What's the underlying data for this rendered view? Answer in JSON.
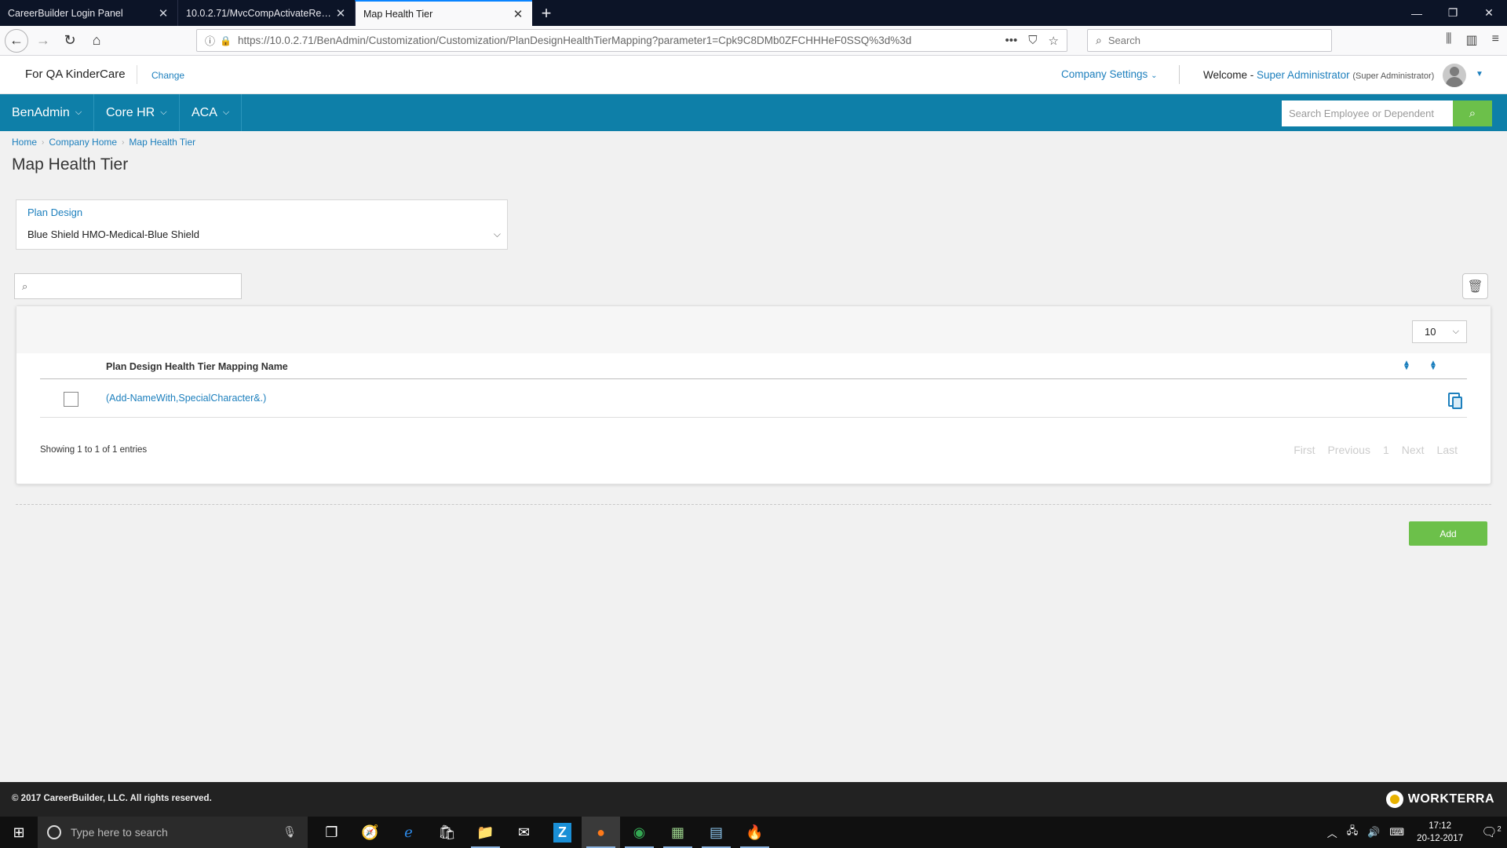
{
  "browser": {
    "tabs": [
      {
        "title": "CareerBuilder Login Panel",
        "active": false
      },
      {
        "title": "10.0.2.71/MvcCompActivateRestore",
        "active": false
      },
      {
        "title": "Map Health Tier",
        "active": true
      }
    ],
    "url": "https://10.0.2.71/BenAdmin/Customization/Customization/PlanDesignHealthTierMapping?parameter1=Cpk9C8DMb0ZFCHHHeF0SSQ%3d%3d",
    "search_placeholder": "Search"
  },
  "header": {
    "company": "For QA KinderCare",
    "change_label": "Change",
    "company_settings": "Company Settings",
    "welcome": "Welcome -",
    "user_name": "Super Administrator",
    "user_role": "(Super Administrator)"
  },
  "nav": {
    "menus": [
      "BenAdmin",
      "Core HR",
      "ACA"
    ],
    "search_placeholder": "Search Employee or Dependent"
  },
  "breadcrumb": [
    "Home",
    "Company Home",
    "Map Health Tier"
  ],
  "page_title": "Map Health Tier",
  "plan_design": {
    "label": "Plan Design",
    "value": "Blue Shield HMO-Medical-Blue Shield"
  },
  "grid": {
    "page_size": "10",
    "column_header": "Plan Design Health Tier Mapping Name",
    "rows": [
      {
        "name": "(Add-NameWith,SpecialCharacter&.)"
      }
    ],
    "showing": "Showing 1 to 1 of 1 entries",
    "pager": [
      "First",
      "Previous",
      "1",
      "Next",
      "Last"
    ]
  },
  "add_label": "Add",
  "footer": {
    "copyright": "© 2017 CareerBuilder, LLC. All rights reserved.",
    "brand": "WORKTERRA"
  },
  "taskbar": {
    "search_placeholder": "Type here to search",
    "time": "17:12",
    "date": "20-12-2017",
    "notifications": "2"
  }
}
